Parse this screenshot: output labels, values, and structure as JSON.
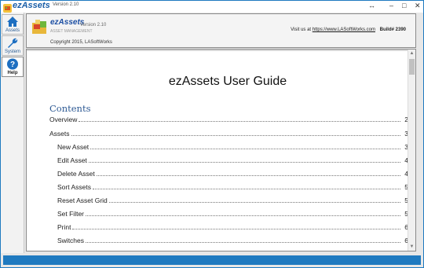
{
  "window": {
    "app_name": "ezAssets",
    "version": "Version 2.10",
    "controls": {
      "restore": "↔",
      "minimize": "–",
      "maximize": "□",
      "close": "✕"
    }
  },
  "nav": {
    "items": [
      {
        "label": "Assets",
        "icon": "home-icon",
        "active": false
      },
      {
        "label": "System",
        "icon": "wrench-icon",
        "active": false
      },
      {
        "label": "Help",
        "icon": "help-icon",
        "active": true
      }
    ]
  },
  "header": {
    "logo_title": "ezAssets",
    "logo_subtitle": "ASSET MANAGEMENT",
    "version": "Version 2.10",
    "copyright": "Copyright 2015, LASoftWorks",
    "visit_prefix": "Visit us at",
    "visit_link": "https://www.LASoftWorks.com",
    "build": "Build# 2390"
  },
  "document": {
    "title": "ezAssets User Guide",
    "contents_heading": "Contents",
    "toc": [
      {
        "title": "Overview",
        "page": "2",
        "level": 1
      },
      {
        "title": "Assets",
        "page": "3",
        "level": 1
      },
      {
        "title": "New Asset",
        "page": "3",
        "level": 2
      },
      {
        "title": "Edit Asset",
        "page": "4",
        "level": 2
      },
      {
        "title": "Delete Asset",
        "page": "4",
        "level": 2
      },
      {
        "title": "Sort Assets",
        "page": "5",
        "level": 2
      },
      {
        "title": "Reset Asset Grid",
        "page": "5",
        "level": 2
      },
      {
        "title": "Set Filter",
        "page": "5",
        "level": 2
      },
      {
        "title": "Print",
        "page": "6",
        "level": 2
      },
      {
        "title": "Switches",
        "page": "6",
        "level": 2
      }
    ]
  },
  "colors": {
    "accent": "#1f7ac0",
    "contents_heading": "#2e5a94"
  }
}
